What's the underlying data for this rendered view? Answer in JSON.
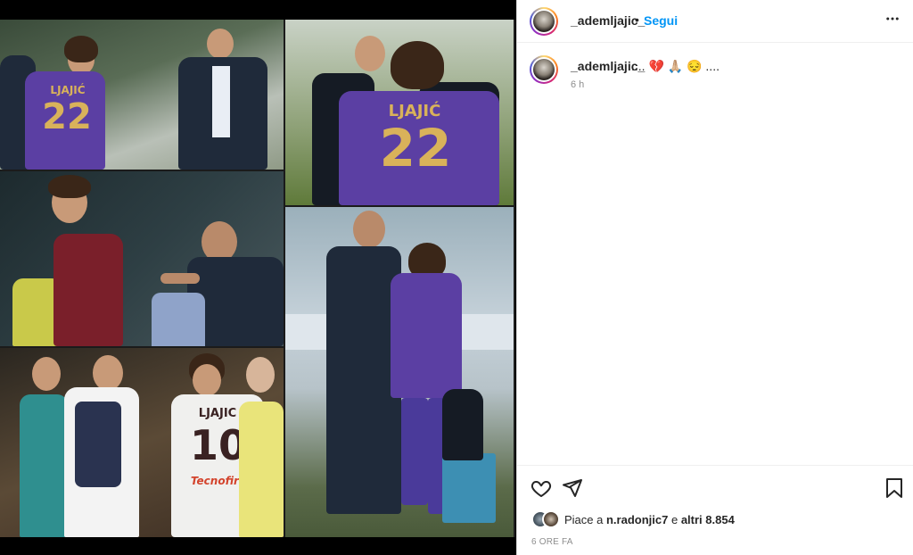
{
  "post": {
    "username": "_ademljajic_",
    "dot": "•",
    "follow_label": "Segui",
    "more_icon": "more-horizontal-icon",
    "caption_text": ".... 💔 🙏🏼 😔 ....",
    "caption_time": "6 h",
    "likes_prefix": "Piace a ",
    "likes_user": "n.radonjic7",
    "likes_middle": " e ",
    "likes_count": "altri 8.854",
    "posted_time": "6 ORE FA"
  },
  "media": {
    "jersey_name_1": "LJAJIĆ",
    "jersey_number_1": "22",
    "jersey_name_2": "LJAJIĆ",
    "jersey_number_2": "22",
    "jersey_name_3": "LJAJIC",
    "jersey_number_3": "10",
    "sponsor_text": "Tecnofire"
  },
  "icons": {
    "like": "heart-icon",
    "share": "send-icon",
    "save": "bookmark-icon"
  },
  "colors": {
    "follow_blue": "#0095f6",
    "text": "#262626",
    "muted": "#8e8e8e"
  }
}
